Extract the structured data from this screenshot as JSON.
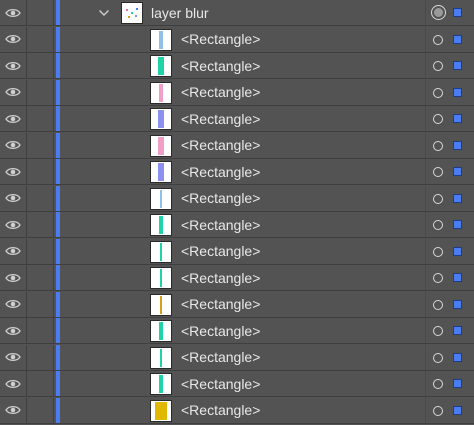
{
  "layer": {
    "name": "layer blur",
    "expanded": true,
    "visibility_icon": "eye-icon",
    "disclosure_icon": "chevron-down-icon",
    "target_icon": "target-double-circle-icon",
    "selection_color": "#4a7df2"
  },
  "rows": [
    {
      "label": "<Rectangle>",
      "stripe_color": "#8ec0e8",
      "stripe_kind": "narrow"
    },
    {
      "label": "<Rectangle>",
      "stripe_color": "#1fd3a7",
      "stripe_kind": "wide"
    },
    {
      "label": "<Rectangle>",
      "stripe_color": "#f0a0c8",
      "stripe_kind": "narrow"
    },
    {
      "label": "<Rectangle>",
      "stripe_color": "#8c90f0",
      "stripe_kind": "wide"
    },
    {
      "label": "<Rectangle>",
      "stripe_color": "#f0a0c8",
      "stripe_kind": "wide"
    },
    {
      "label": "<Rectangle>",
      "stripe_color": "#8c90f0",
      "stripe_kind": "wide"
    },
    {
      "label": "<Rectangle>",
      "stripe_color": "#8ec0e8",
      "stripe_kind": "hair"
    },
    {
      "label": "<Rectangle>",
      "stripe_color": "#1fd3a7",
      "stripe_kind": "narrow"
    },
    {
      "label": "<Rectangle>",
      "stripe_color": "#1fd3a7",
      "stripe_kind": "hair"
    },
    {
      "label": "<Rectangle>",
      "stripe_color": "#1fd3a7",
      "stripe_kind": "hair"
    },
    {
      "label": "<Rectangle>",
      "stripe_color": "#d4a017",
      "stripe_kind": "hair"
    },
    {
      "label": "<Rectangle>",
      "stripe_color": "#1fd3a7",
      "stripe_kind": "narrow"
    },
    {
      "label": "<Rectangle>",
      "stripe_color": "#1fd3a7",
      "stripe_kind": "hair"
    },
    {
      "label": "<Rectangle>",
      "stripe_color": "#1fd3a7",
      "stripe_kind": "narrow"
    },
    {
      "label": "<Rectangle>",
      "stripe_color": "#e0b800",
      "stripe_kind": "full"
    }
  ],
  "colors": {
    "panel_bg": "#535353",
    "row_border": "#3f3f3f",
    "text": "#e8e8e8",
    "accent": "#4a7df2"
  }
}
